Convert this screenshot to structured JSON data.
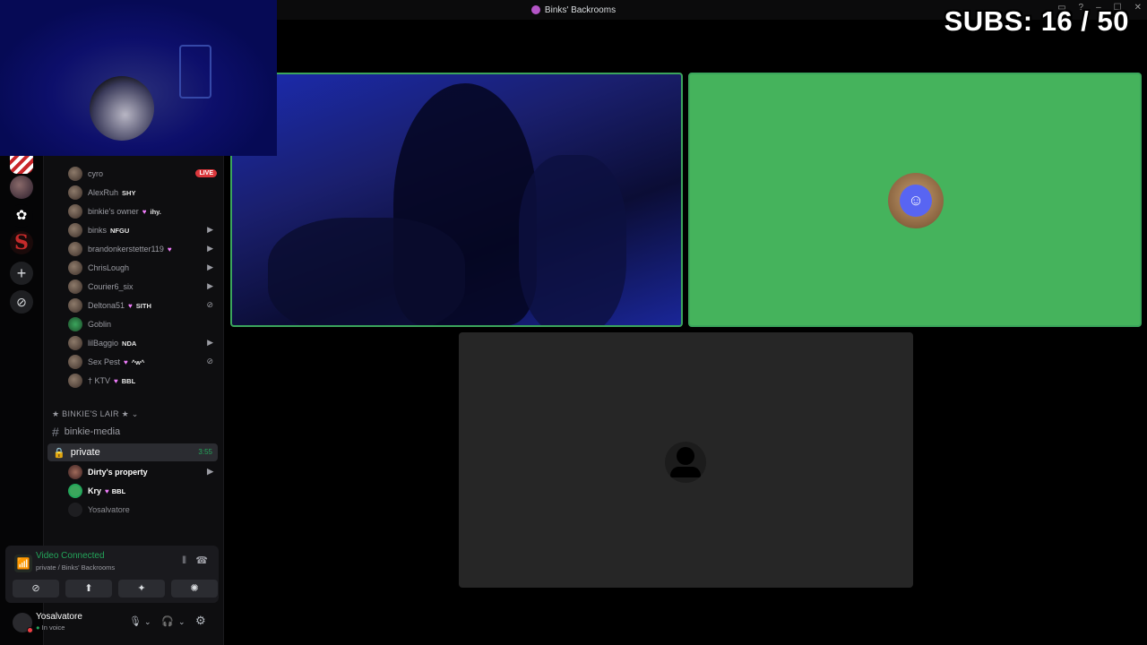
{
  "window": {
    "title": "Binks' Backrooms",
    "controls": [
      "▭",
      "?",
      "–",
      "☐",
      "✕"
    ]
  },
  "overlay": {
    "subs_text": "SUBS: 16 / 50"
  },
  "server_rail": {
    "servers": [
      "striped-server",
      "avatar-server",
      "butterfly-server",
      "s-server"
    ],
    "add_label": "+",
    "discover_label": "⊘"
  },
  "voice_channel_users": [
    {
      "name": "cyro",
      "badge": "LIVE",
      "tag": "",
      "icon": ""
    },
    {
      "name": "AlexRuh",
      "badge": "",
      "tag": "SHY",
      "icon": ""
    },
    {
      "name": "binkie's owner",
      "badge": "",
      "tag": "ihy.",
      "icon": ""
    },
    {
      "name": "binks",
      "badge": "",
      "tag": "NFGU",
      "icon": "video-icon"
    },
    {
      "name": "brandonkerstetter119",
      "badge": "",
      "tag": "",
      "icon": "video-icon"
    },
    {
      "name": "ChrisLough",
      "badge": "",
      "tag": "",
      "icon": "video-icon"
    },
    {
      "name": "Courier6_six",
      "badge": "",
      "tag": "",
      "icon": "video-icon"
    },
    {
      "name": "Deltona51",
      "badge": "",
      "tag": "SITH",
      "icon": "mute-icon"
    },
    {
      "name": "Goblin",
      "badge": "",
      "tag": "",
      "icon": ""
    },
    {
      "name": "lilBaggio",
      "badge": "",
      "tag": "NDA",
      "icon": "video-icon"
    },
    {
      "name": "Sex Pest",
      "badge": "",
      "tag": "^w^",
      "icon": "mute-icon"
    },
    {
      "name": "† KTV",
      "badge": "",
      "tag": "BBL",
      "icon": ""
    }
  ],
  "sidebar": {
    "category_label": "★ BINKIE'S LAIR ★ ⌄",
    "text_channel": "binkie-media",
    "voice_channel": {
      "name": "private",
      "timer": "3:55"
    },
    "private_users": [
      {
        "name": "Dirty's property",
        "tag": "",
        "icon": "video-icon"
      },
      {
        "name": "Kry",
        "tag": "BBL",
        "icon": ""
      },
      {
        "name": "Yosalvatore",
        "tag": "",
        "icon": ""
      }
    ]
  },
  "rtc": {
    "status": "Video Connected",
    "location": "private / Binks' Backrooms",
    "buttons": [
      "camera-off",
      "share-screen",
      "activities",
      "soundboard"
    ]
  },
  "user": {
    "name": "Yosalvatore",
    "status": "In voice"
  },
  "colors": {
    "accent_green": "#23a55a",
    "speaking_border": "#3ba55c",
    "tile_green": "#45b35c",
    "live_red": "#da373c",
    "discord_blurple": "#5865f2"
  }
}
